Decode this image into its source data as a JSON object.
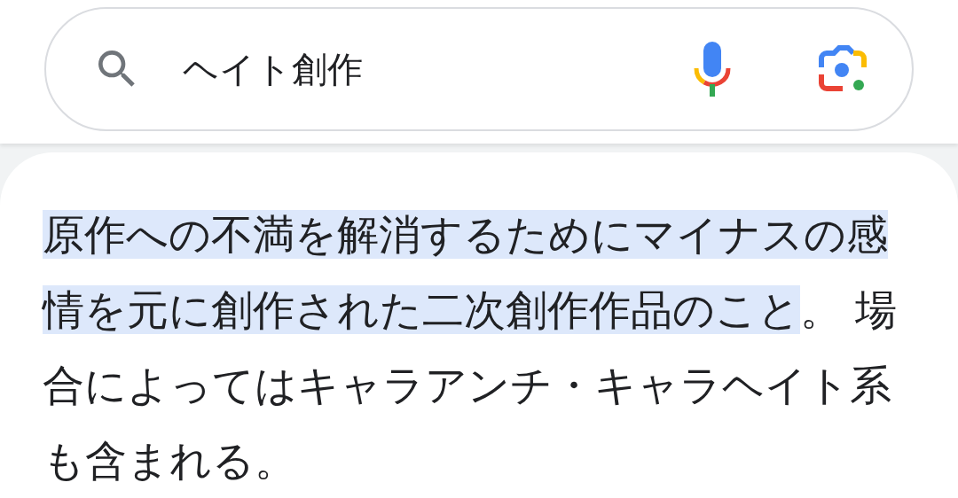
{
  "search": {
    "value": "ヘイト創作"
  },
  "snippet": {
    "highlighted": "原作への不満を解消するためにマイナスの感情を元に創作された二次創作作品のこと",
    "rest": "。 場合によってはキャラアンチ・キャラヘイト系も含まれる。"
  }
}
